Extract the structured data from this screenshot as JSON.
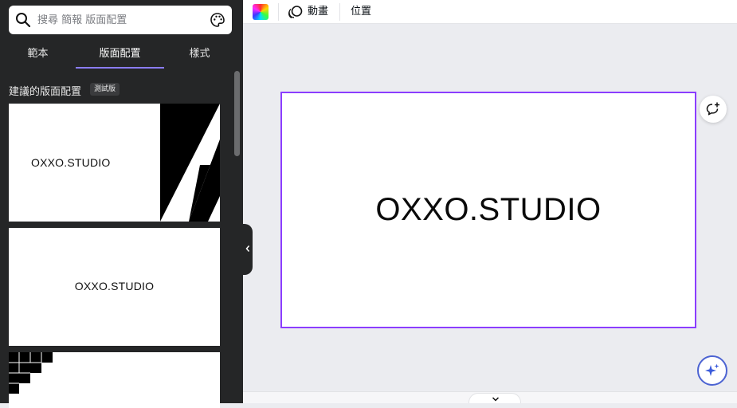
{
  "search": {
    "placeholder": "搜尋 簡報 版面配置"
  },
  "tabs": [
    {
      "label": "範本"
    },
    {
      "label": "版面配置",
      "active": true
    },
    {
      "label": "樣式"
    }
  ],
  "section": {
    "title": "建議的版面配置",
    "badge": "測試版"
  },
  "cards": [
    {
      "text": "OXXO.STUDIO"
    },
    {
      "text": "OXXO.STUDIO"
    }
  ],
  "toolbar": {
    "animate_label": "動畫",
    "position_label": "位置"
  },
  "canvas": {
    "text": "OXXO.STUDIO"
  },
  "colors": {
    "accent": "#8b3dff",
    "tab_underline": "#8b7dff",
    "sidebar_bg": "#252627",
    "magic_ring": "#4c63d2"
  },
  "icons": [
    "search-icon",
    "palette-icon",
    "color-swatch",
    "animate-icon",
    "chevron-left-icon",
    "add-comment-icon",
    "magic-sparkle-icon",
    "chevron-down-icon"
  ]
}
